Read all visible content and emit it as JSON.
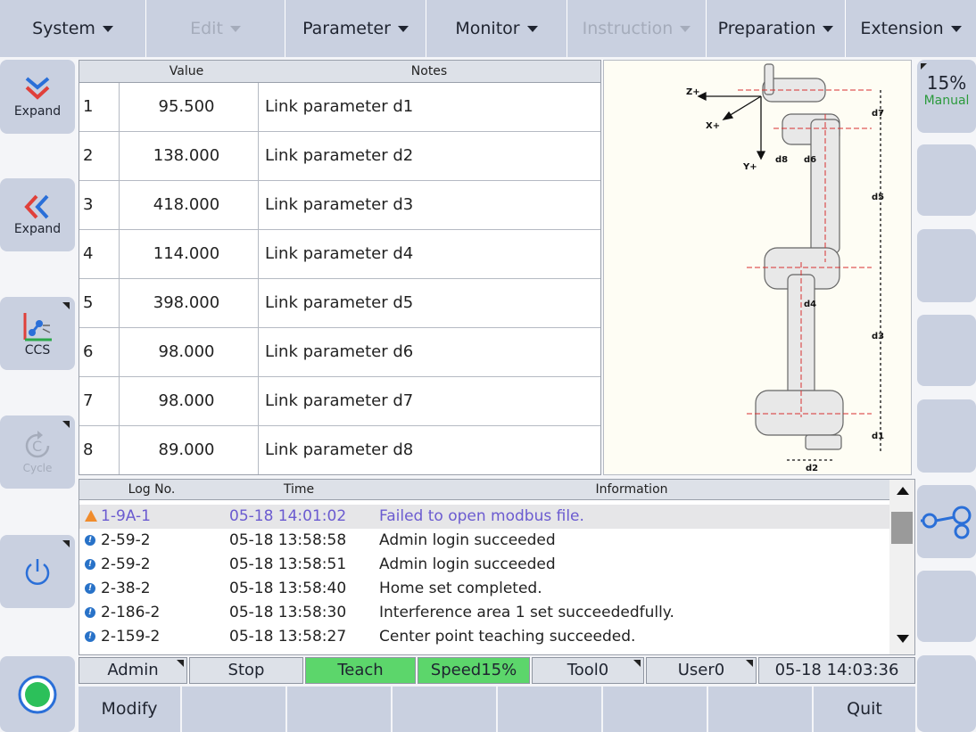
{
  "menu": [
    {
      "label": "System",
      "enabled": true
    },
    {
      "label": "Edit",
      "enabled": false
    },
    {
      "label": "Parameter",
      "enabled": true
    },
    {
      "label": "Monitor",
      "enabled": true
    },
    {
      "label": "Instruction",
      "enabled": false
    },
    {
      "label": "Preparation",
      "enabled": true
    },
    {
      "label": "Extension",
      "enabled": true
    }
  ],
  "left": {
    "expand_down_label": "Expand",
    "expand_left_label": "Expand",
    "ccs_label": "CCS",
    "cycle_label": "Cycle"
  },
  "right": {
    "speed": "15%",
    "mode": "Manual"
  },
  "params": {
    "headers": {
      "index": "",
      "value": "Value",
      "notes": "Notes"
    },
    "rows": [
      {
        "index": "1",
        "value": "95.500",
        "note": "Link parameter d1"
      },
      {
        "index": "2",
        "value": "138.000",
        "note": "Link parameter d2"
      },
      {
        "index": "3",
        "value": "418.000",
        "note": "Link parameter d3"
      },
      {
        "index": "4",
        "value": "114.000",
        "note": "Link parameter d4"
      },
      {
        "index": "5",
        "value": "398.000",
        "note": "Link parameter d5"
      },
      {
        "index": "6",
        "value": "98.000",
        "note": "Link parameter d6"
      },
      {
        "index": "7",
        "value": "98.000",
        "note": "Link parameter d7"
      },
      {
        "index": "8",
        "value": "89.000",
        "note": "Link parameter d8"
      }
    ]
  },
  "diagram": {
    "labels": [
      "Z+",
      "X+",
      "Y+",
      "d8",
      "d6",
      "d7",
      "d5",
      "d4",
      "d3",
      "d1",
      "d2"
    ]
  },
  "log": {
    "headers": {
      "no": "Log No.",
      "time": "Time",
      "info": "Information"
    },
    "rows": [
      {
        "level": "warning",
        "no": "1-9A-1",
        "time": "05-18 14:01:02",
        "info": "Failed to open modbus file."
      },
      {
        "level": "info",
        "no": "2-59-2",
        "time": "05-18 13:58:58",
        "info": "Admin  login succeeded"
      },
      {
        "level": "info",
        "no": "2-59-2",
        "time": "05-18 13:58:51",
        "info": "Admin  login succeeded"
      },
      {
        "level": "info",
        "no": "2-38-2",
        "time": "05-18 13:58:40",
        "info": "Home set completed."
      },
      {
        "level": "info",
        "no": "2-186-2",
        "time": "05-18 13:58:30",
        "info": "Interference area 1 set succeededfully."
      },
      {
        "level": "info",
        "no": "2-159-2",
        "time": "05-18 13:58:27",
        "info": "Center point teaching succeeded."
      }
    ]
  },
  "status": {
    "user": "Admin",
    "run": "Stop",
    "mode": "Teach",
    "speed": "Speed15%",
    "tool": "Tool0",
    "userframe": "User0",
    "datetime": "05-18 14:03:36"
  },
  "bottom": {
    "modify": "Modify",
    "quit": "Quit"
  },
  "colors": {
    "button_bg": "#c9d0e0",
    "teach_green": "#5cd66b",
    "warn_purple": "#6b5bd0",
    "info_blue": "#2872c8"
  }
}
